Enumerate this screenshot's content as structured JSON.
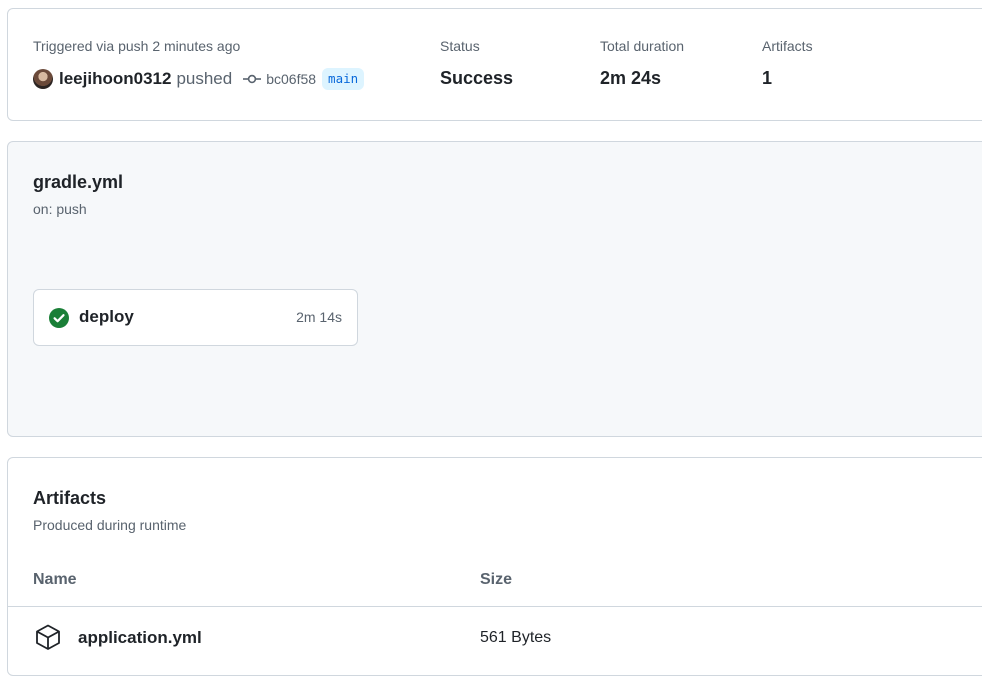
{
  "summary": {
    "trigger_text": "Triggered via push 2 minutes ago",
    "actor": "leejihoon0312",
    "action": "pushed",
    "commit_sha": "bc06f58",
    "branch": "main",
    "status_label": "Status",
    "status_value": "Success",
    "duration_label": "Total duration",
    "duration_value": "2m 24s",
    "artifacts_label": "Artifacts",
    "artifacts_value": "1"
  },
  "workflow": {
    "name": "gradle.yml",
    "trigger": "on: push",
    "jobs": [
      {
        "name": "deploy",
        "duration": "2m 14s",
        "status": "success"
      }
    ]
  },
  "artifacts": {
    "title": "Artifacts",
    "subtitle": "Produced during runtime",
    "columns": [
      "Name",
      "Size"
    ],
    "rows": [
      {
        "name": "application.yml",
        "size": "561 Bytes",
        "icon": "package-icon"
      }
    ]
  },
  "colors": {
    "success": "#1a7f37",
    "link": "#0969da",
    "branch_bg": "#ddf4ff",
    "muted": "#59636e",
    "border": "#d0d7de",
    "panel_bg": "#f6f8fa"
  }
}
